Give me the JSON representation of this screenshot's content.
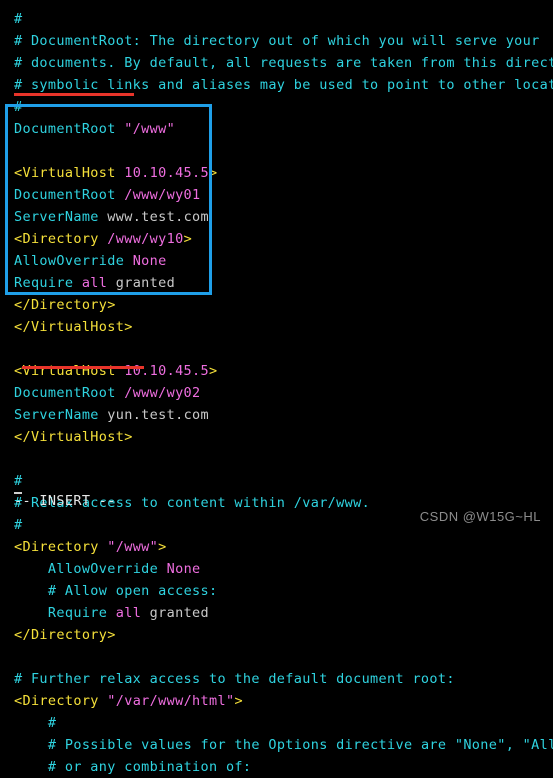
{
  "terminal": {
    "app": "vim",
    "status_line": "-- INSERT --",
    "cursor": "block-cursor",
    "colors": {
      "background": "#000000",
      "comment": "#2fd3e0",
      "keyword": "#2fd3e0",
      "tag": "#f5e03a",
      "string": "#ef6ee0",
      "plain": "#c9c9c9",
      "highlight_box_border": "#1f9fe8",
      "underline": "#e8342a",
      "watermark": "#8d8d8d"
    }
  },
  "watermark": {
    "text": "CSDN @W15G~HL"
  },
  "lines": [
    {
      "id": "l1",
      "segments": [
        {
          "cls": "cmt",
          "text": "#"
        }
      ]
    },
    {
      "id": "l2",
      "segments": [
        {
          "cls": "cmt",
          "text": "# DocumentRoot: The directory out of which you will serve your"
        }
      ]
    },
    {
      "id": "l3",
      "segments": [
        {
          "cls": "cmt",
          "text": "# documents. By default, all requests are taken from this directory, but"
        }
      ]
    },
    {
      "id": "l4",
      "segments": [
        {
          "cls": "cmt",
          "text": "# symbolic links and aliases may be used to point to other locations."
        }
      ]
    },
    {
      "id": "l5",
      "segments": [
        {
          "cls": "cmt",
          "text": "#"
        }
      ]
    },
    {
      "id": "l6",
      "segments": [
        {
          "cls": "key",
          "text": "DocumentRoot"
        },
        {
          "cls": "plain",
          "text": " "
        },
        {
          "cls": "str",
          "text": "\"/www\""
        }
      ]
    },
    {
      "id": "l7",
      "segments": [
        {
          "cls": "plain",
          "text": ""
        }
      ]
    },
    {
      "id": "l8",
      "segments": [
        {
          "cls": "tag",
          "text": "<VirtualHost"
        },
        {
          "cls": "plain",
          "text": " "
        },
        {
          "cls": "val",
          "text": "10.10.45.5"
        },
        {
          "cls": "tag",
          "text": ">"
        }
      ]
    },
    {
      "id": "l9",
      "segments": [
        {
          "cls": "key",
          "text": "DocumentRoot"
        },
        {
          "cls": "plain",
          "text": " "
        },
        {
          "cls": "pathm",
          "text": "/www/wy01"
        }
      ]
    },
    {
      "id": "l10",
      "segments": [
        {
          "cls": "key",
          "text": "ServerName"
        },
        {
          "cls": "plain",
          "text": " "
        },
        {
          "cls": "plain",
          "text": "www.test.com"
        }
      ]
    },
    {
      "id": "l11",
      "segments": [
        {
          "cls": "tag",
          "text": "<Directory"
        },
        {
          "cls": "plain",
          "text": " "
        },
        {
          "cls": "pathm",
          "text": "/www/wy10"
        },
        {
          "cls": "tag",
          "text": ">"
        }
      ]
    },
    {
      "id": "l12",
      "segments": [
        {
          "cls": "key",
          "text": "AllowOverride"
        },
        {
          "cls": "plain",
          "text": " "
        },
        {
          "cls": "val",
          "text": "None"
        }
      ]
    },
    {
      "id": "l13",
      "segments": [
        {
          "cls": "key",
          "text": "Require"
        },
        {
          "cls": "plain",
          "text": " "
        },
        {
          "cls": "val",
          "text": "all"
        },
        {
          "cls": "plain",
          "text": " granted"
        }
      ]
    },
    {
      "id": "l14",
      "segments": [
        {
          "cls": "tag",
          "text": "</Directory>"
        }
      ]
    },
    {
      "id": "l15",
      "segments": [
        {
          "cls": "tag",
          "text": "</VirtualHost>"
        }
      ]
    },
    {
      "id": "l16",
      "segments": [
        {
          "cls": "plain",
          "text": ""
        }
      ]
    },
    {
      "id": "l17",
      "segments": [
        {
          "cls": "tag",
          "text": "<VirtualHost"
        },
        {
          "cls": "plain",
          "text": " "
        },
        {
          "cls": "val",
          "text": "10.10.45.5"
        },
        {
          "cls": "tag",
          "text": ">"
        }
      ]
    },
    {
      "id": "l18",
      "segments": [
        {
          "cls": "key",
          "text": "DocumentRoot"
        },
        {
          "cls": "plain",
          "text": " "
        },
        {
          "cls": "pathm",
          "text": "/www/wy02"
        }
      ]
    },
    {
      "id": "l19",
      "segments": [
        {
          "cls": "key",
          "text": "ServerName"
        },
        {
          "cls": "plain",
          "text": " "
        },
        {
          "cls": "plain",
          "text": "yun.test.com"
        }
      ]
    },
    {
      "id": "l20",
      "segments": [
        {
          "cls": "tag",
          "text": "</VirtualHost>"
        }
      ]
    },
    {
      "id": "l21",
      "segments": [
        {
          "cls": "plain",
          "text": ""
        }
      ]
    },
    {
      "id": "l22",
      "segments": [
        {
          "cls": "cmt",
          "text": "#"
        }
      ]
    },
    {
      "id": "l23",
      "segments": [
        {
          "cls": "cmt",
          "text": "# Relax access to content within /var/www."
        }
      ]
    },
    {
      "id": "l24",
      "segments": [
        {
          "cls": "cmt",
          "text": "#"
        }
      ]
    },
    {
      "id": "l25",
      "segments": [
        {
          "cls": "tag",
          "text": "<Directory"
        },
        {
          "cls": "plain",
          "text": " "
        },
        {
          "cls": "str",
          "text": "\"/www\""
        },
        {
          "cls": "tag",
          "text": ">"
        }
      ]
    },
    {
      "id": "l26",
      "segments": [
        {
          "cls": "plain",
          "text": "    "
        },
        {
          "cls": "key",
          "text": "AllowOverride"
        },
        {
          "cls": "plain",
          "text": " "
        },
        {
          "cls": "val",
          "text": "None"
        }
      ]
    },
    {
      "id": "l27",
      "segments": [
        {
          "cls": "plain",
          "text": "    "
        },
        {
          "cls": "cmt",
          "text": "# Allow open access:"
        }
      ]
    },
    {
      "id": "l28",
      "segments": [
        {
          "cls": "plain",
          "text": "    "
        },
        {
          "cls": "key",
          "text": "Require"
        },
        {
          "cls": "plain",
          "text": " "
        },
        {
          "cls": "val",
          "text": "all"
        },
        {
          "cls": "plain",
          "text": " granted"
        }
      ]
    },
    {
      "id": "l29",
      "segments": [
        {
          "cls": "tag",
          "text": "</Directory>"
        }
      ]
    },
    {
      "id": "l30",
      "segments": [
        {
          "cls": "plain",
          "text": ""
        }
      ]
    },
    {
      "id": "l31",
      "segments": [
        {
          "cls": "cmt",
          "text": "# Further relax access to the default document root:"
        }
      ]
    },
    {
      "id": "l32",
      "segments": [
        {
          "cls": "tag",
          "text": "<Directory"
        },
        {
          "cls": "plain",
          "text": " "
        },
        {
          "cls": "str",
          "text": "\"/var/www/html\""
        },
        {
          "cls": "tag",
          "text": ">"
        }
      ]
    },
    {
      "id": "l33",
      "segments": [
        {
          "cls": "plain",
          "text": "    "
        },
        {
          "cls": "cmt",
          "text": "#"
        }
      ]
    },
    {
      "id": "l34",
      "segments": [
        {
          "cls": "plain",
          "text": "    "
        },
        {
          "cls": "cmt",
          "text": "# Possible values for the Options directive are \"None\", \"All\","
        }
      ]
    },
    {
      "id": "l35",
      "segments": [
        {
          "cls": "plain",
          "text": "    "
        },
        {
          "cls": "cmt",
          "text": "# or any combination of:"
        }
      ]
    }
  ],
  "annotations": {
    "vhost_box": {
      "label": "virtualhost-highlight-box"
    },
    "underline_documentroot": {
      "label": "documentroot-underline"
    },
    "underline_directory": {
      "label": "directory-underline"
    }
  }
}
